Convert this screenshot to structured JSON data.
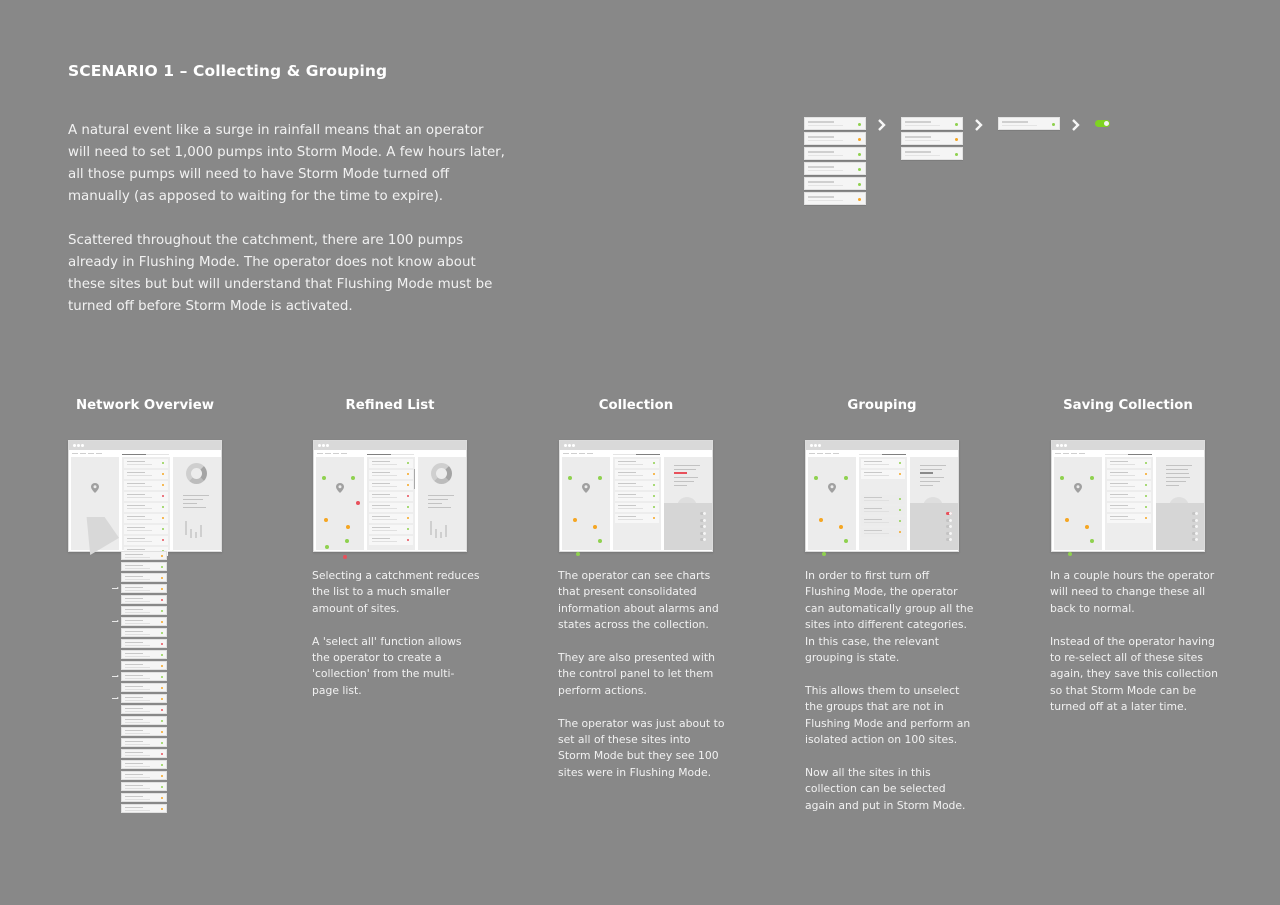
{
  "header": {
    "title": "SCENARIO 1 – Collecting & Grouping",
    "intro": [
      "A natural event like a surge in rainfall means that an operator\nwill need to set 1,000 pumps into Storm Mode. A few hours later,\nall those pumps will need to have Storm Mode turned off\nmanually (as apposed to waiting for the time to expire).",
      "Scattered throughout the catchment, there are 100 pumps\nalready in Flushing Mode. The operator does not know about\nthese sites but but will understand that Flushing Mode must be\nturned off before Storm Mode is activated."
    ]
  },
  "colors": {
    "background": "#888888",
    "green": "#8fd14f",
    "orange": "#f5a623",
    "red": "#e8505b",
    "toggle_on": "#7ed321"
  },
  "flow": {
    "stages": [
      {
        "name": "all-sites",
        "cards": [
          "green",
          "orange",
          "green",
          "green",
          "green",
          "orange"
        ]
      },
      {
        "name": "filtered",
        "cards": [
          "green",
          "orange",
          "green"
        ]
      },
      {
        "name": "single",
        "cards": [
          "green"
        ]
      }
    ],
    "separator_icon": "chevron-right-icon",
    "result": {
      "icon": "toggle-switch-icon",
      "state": "on"
    }
  },
  "steps": [
    {
      "title": "Network Overview",
      "description": [],
      "list_dots": [
        "green",
        "orange",
        "orange",
        "red",
        "green",
        "orange",
        "green",
        "red",
        "green",
        "orange",
        "green",
        "orange",
        "orange",
        "red",
        "green",
        "orange",
        "green",
        "red",
        "green",
        "orange",
        "green",
        "orange",
        "orange",
        "red",
        "green",
        "orange",
        "green",
        "red",
        "green",
        "orange",
        "green",
        "orange",
        "orange"
      ],
      "selected_rows": [
        3,
        6,
        11,
        13
      ]
    },
    {
      "title": "Refined List",
      "description": [
        "Selecting a catchment reduces\nthe list to a much smaller\namount of sites.",
        "A 'select all' function allows\nthe operator to create a\n'collection'  from the multi-\npage list."
      ],
      "list_dots": [
        "green",
        "orange",
        "orange",
        "red",
        "green",
        "orange",
        "green",
        "red"
      ],
      "map_dots": [
        "green",
        "green",
        "red",
        "orange",
        "orange",
        "green",
        "green",
        "red"
      ]
    },
    {
      "title": "Collection",
      "description": [
        "The operator can see charts\nthat present consolidated\ninformation about alarms and\nstates across the collection.",
        "They are also presented with\nthe control panel to let them\nperform actions.",
        "The operator was just about to\nset all of these sites into\nStorm Mode but they see 100\nsites were in Flushing Mode."
      ],
      "list_dots": [
        "green",
        "orange",
        "green",
        "green",
        "green",
        "orange"
      ],
      "map_dots": [
        "green",
        "green",
        "orange",
        "orange",
        "green",
        "green"
      ],
      "toggles": [
        "off",
        "off",
        "off",
        "off",
        "off"
      ]
    },
    {
      "title": "Grouping",
      "description": [
        "In order to first turn off\nFlushing Mode,  the operator\ncan automatically group all the\nsites into different categories.\nIn this case, the relevant\ngrouping is state.",
        "This allows them to unselect\nthe groups that are not in\nFlushing Mode and perform an\nisolated action on 100 sites.",
        "Now all the sites in this\ncollection can be selected\nagain and put in Storm Mode."
      ],
      "list_dots": [
        "green",
        "orange",
        "green",
        "green",
        "green",
        "orange"
      ],
      "map_dots": [
        "green",
        "green",
        "orange",
        "orange",
        "green",
        "green"
      ],
      "toggles": [
        "on",
        "off",
        "off",
        "off",
        "off"
      ]
    },
    {
      "title": "Saving Collection",
      "description": [
        "In a couple hours the operator\nwill need to change these all\nback to normal.",
        "Instead of the operator having\nto re-select all of these sites\nagain, they  save this collection\nso that Storm Mode can be\nturned off at a later time."
      ],
      "list_dots": [
        "green",
        "orange",
        "green",
        "green",
        "green",
        "orange"
      ],
      "map_dots": [
        "green",
        "green",
        "orange",
        "orange",
        "green",
        "green"
      ],
      "toggles": [
        "off",
        "off",
        "off",
        "off",
        "off"
      ]
    }
  ]
}
